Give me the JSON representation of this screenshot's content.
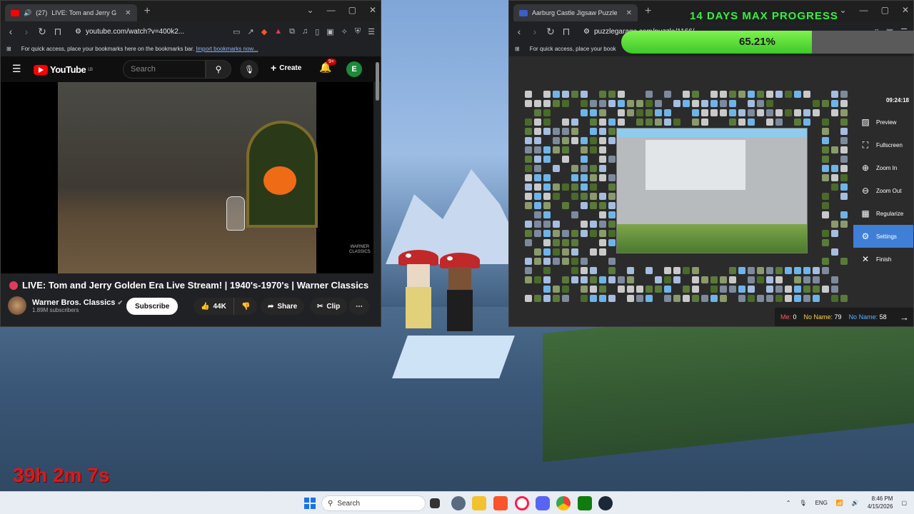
{
  "stream_overlay": {
    "timer": "39h 2m 7s",
    "progress_title": "14 DAYS MAX PROGRESS",
    "progress_value": 0.6521,
    "progress_label": "65.21%"
  },
  "youtube_window": {
    "tab_title": "LIVE: Tom and Jerry G",
    "tab_count": "(27)",
    "url": "youtube.com/watch?v=400k2...",
    "bookmarks_hint": "For quick access, place your bookmarks here on the bookmarks bar.",
    "bookmarks_link": "Import bookmarks now...",
    "logo_text": "YouTube",
    "logo_country": "LB",
    "search_placeholder": "Search",
    "create_label": "Create",
    "notifications_badge": "9+",
    "avatar_letter": "E",
    "video_watermark": "WARNER CLASSICS",
    "video_title": "LIVE: Tom and Jerry Golden Era Live Stream! | 1940's-1970's | Warner Classics",
    "channel_name": "Warner Bros. Classics",
    "channel_subscribers": "1.89M subscribers",
    "subscribe_label": "Subscribe",
    "like_count": "44K",
    "share_label": "Share",
    "clip_label": "Clip"
  },
  "puzzle_window": {
    "tab_title": "Aarburg Castle Jigsaw Puzzle",
    "url": "puzzlegarage.com/puzzle/1166/",
    "bookmarks_hint": "For quick access, place your book",
    "elapsed": "09:24:18",
    "menu": [
      {
        "label": "Preview",
        "icon": "image-icon"
      },
      {
        "label": "Fullscreen",
        "icon": "fullscreen-icon"
      },
      {
        "label": "Zoom In",
        "icon": "zoom-in-icon"
      },
      {
        "label": "Zoom Out",
        "icon": "zoom-out-icon"
      },
      {
        "label": "Regularize",
        "icon": "grid-icon"
      },
      {
        "label": "Settings",
        "icon": "gear-icon"
      },
      {
        "label": "Finish",
        "icon": "close-icon"
      }
    ],
    "active_menu": "Settings",
    "players": [
      {
        "name": "Me",
        "count": "0",
        "color": "#ff5a5a"
      },
      {
        "name": "No Name",
        "count": "79",
        "color": "#ffd33a"
      },
      {
        "name": "No Name",
        "count": "58",
        "color": "#5ab4ff"
      }
    ]
  },
  "taskbar": {
    "search_placeholder": "Search",
    "language": "ENG",
    "time": "8:46 PM",
    "date": "4/15/2026"
  },
  "colors": {
    "youtube_red": "#ff0000",
    "progress_green": "#3ec82a",
    "settings_active": "#3f7fd6",
    "timer_red": "#d81b1b"
  }
}
